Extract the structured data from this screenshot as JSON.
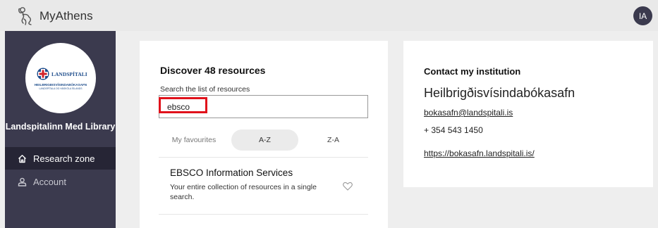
{
  "header": {
    "brand": "MyAthens",
    "avatar_initials": "IA",
    "logo_icon": "athens-figure-icon"
  },
  "sidebar": {
    "library_name": "Landspitalinn Med Library",
    "logo": {
      "org": "LANDSPÍTALI",
      "line1": "HEILBRIGÐISVÍSINDABÓKASAFN",
      "line2": "LANDSPÍTALA OG HÁSKÓLA ÍSLANDS"
    },
    "items": [
      {
        "label": "Research zone",
        "icon": "home-icon",
        "active": true
      },
      {
        "label": "Account",
        "icon": "user-icon",
        "active": false
      }
    ]
  },
  "discover": {
    "title": "Discover 48 resources",
    "search_label": "Search the list of resources",
    "search_value": "ebsco",
    "sort_tabs": [
      "My favourites",
      "A-Z",
      "Z-A"
    ],
    "selected_sort": "A-Z",
    "results": [
      {
        "title": "EBSCO Information Services",
        "description": "Your entire collection of resources in a single search."
      }
    ]
  },
  "contact": {
    "title": "Contact my institution",
    "name": "Heilbrigðisvísindabókasafn",
    "email": "bokasafn@landspitali.is",
    "phone": "+ 354 543 1450",
    "website": "https://bokasafn.landspitali.is/"
  },
  "colors": {
    "sidebar_bg": "#3b3a4e",
    "sidebar_active": "#262535",
    "highlight_red": "#e0121b",
    "logo_blue": "#1f4e8c",
    "logo_red": "#d2232a"
  }
}
